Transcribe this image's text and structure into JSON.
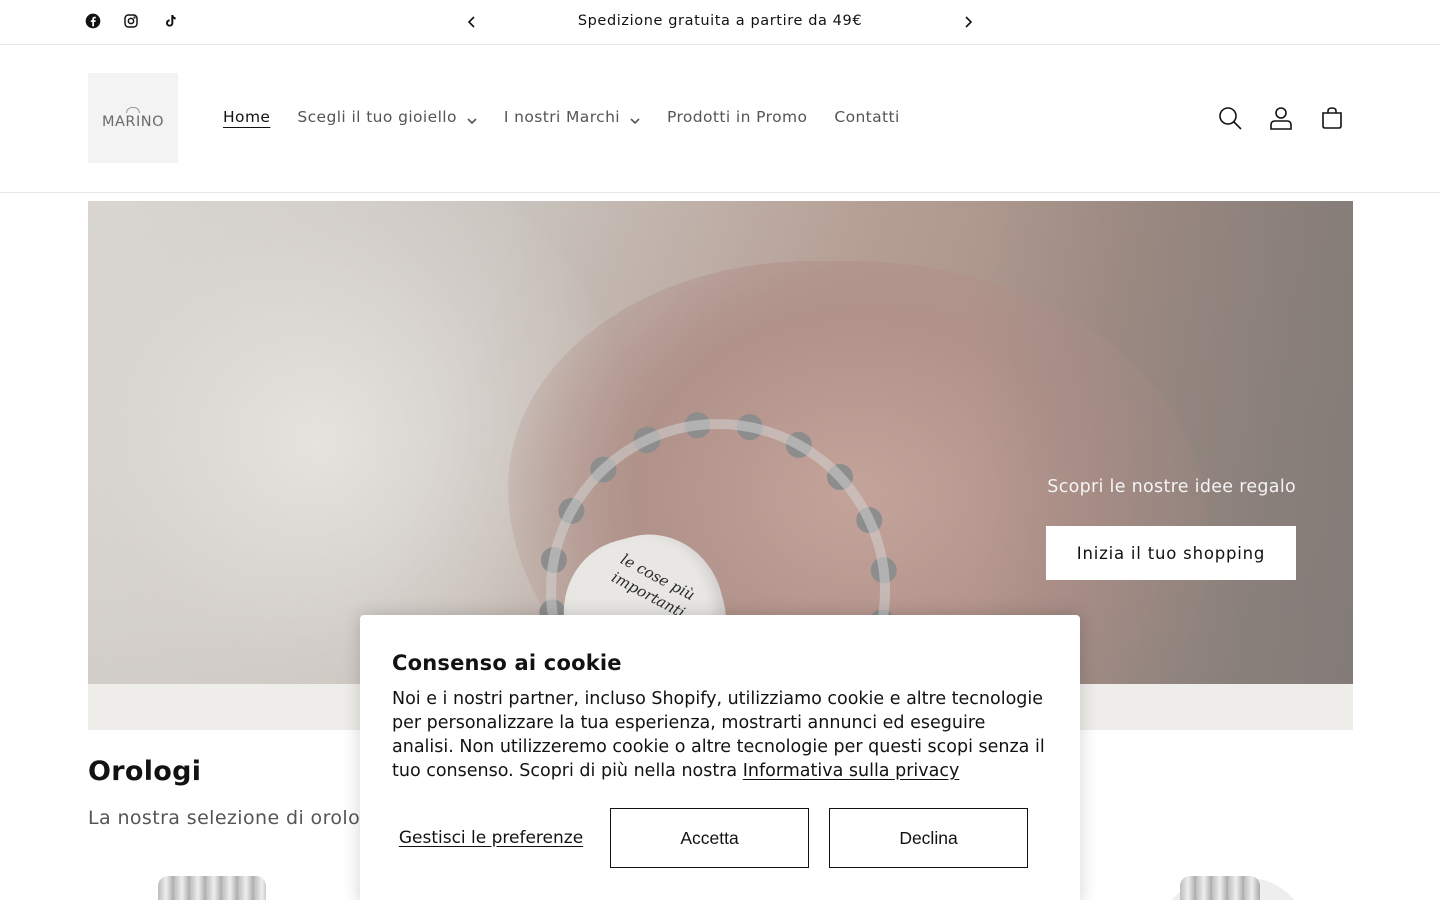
{
  "announcement": {
    "text": "Spedizione gratuita a partire da 49€",
    "social": [
      "facebook-icon",
      "instagram-icon",
      "tiktok-icon"
    ]
  },
  "header": {
    "logo_text": "MARINO",
    "nav": [
      {
        "label": "Home",
        "active": true
      },
      {
        "label": "Scegli il tuo gioiello",
        "has_dropdown": true
      },
      {
        "label": "I nostri Marchi",
        "has_dropdown": true
      },
      {
        "label": "Prodotti in Promo"
      },
      {
        "label": "Contatti"
      }
    ],
    "icons": [
      "search-icon",
      "account-icon",
      "cart-icon"
    ]
  },
  "hero": {
    "charm_text": "le cose più importanti",
    "caption": "Scopri le nostre idee regalo",
    "button_label": "Inizia il tuo shopping"
  },
  "collection": {
    "title": "Orologi",
    "subtitle": "La nostra selezione di orologi"
  },
  "cookie": {
    "title": "Consenso ai cookie",
    "body": "Noi e i nostri partner, incluso Shopify, utilizziamo cookie e altre tecnologie per personalizzare la tua esperienza, mostrarti annunci ed eseguire analisi. Non utilizzeremo cookie o altre tecnologie per questi scopi senza il tuo consenso. Scopri di più nella nostra",
    "privacy_link": "Informativa sulla privacy",
    "manage_label": "Gestisci le preferenze",
    "accept_label": "Accetta",
    "decline_label": "Declina"
  }
}
